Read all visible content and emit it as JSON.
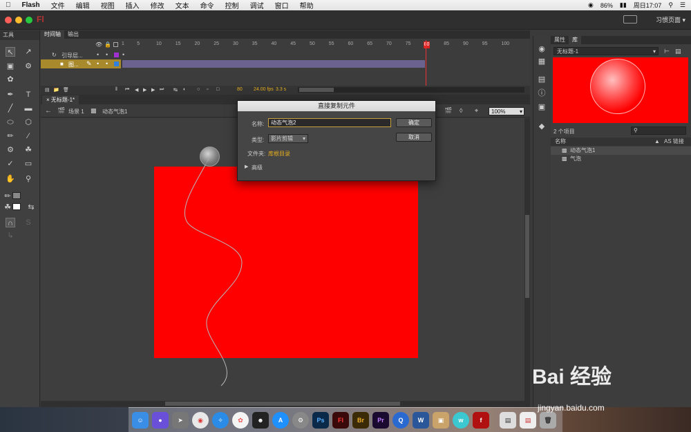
{
  "menubar": {
    "apple_icon": "apple-icon",
    "items": [
      "Flash",
      "文件",
      "编辑",
      "视图",
      "插入",
      "修改",
      "文本",
      "命令",
      "控制",
      "调试",
      "窗口",
      "帮助"
    ],
    "battery": "86%",
    "datetime": "周日17:07"
  },
  "titlebar": {
    "app_logo": "Fl",
    "workspace": "习惯页面"
  },
  "tools": {
    "header": "工具"
  },
  "timeline": {
    "tabs": [
      "时间轴",
      "输出"
    ],
    "ruler": [
      "1",
      "5",
      "10",
      "15",
      "20",
      "25",
      "30",
      "35",
      "40",
      "45",
      "50",
      "55",
      "60",
      "65",
      "70",
      "75",
      "80",
      "85",
      "90",
      "95",
      "100"
    ],
    "current_frame_marker": "80",
    "layers": [
      {
        "name": "引导层..."
      },
      {
        "name": "图..."
      }
    ],
    "status": {
      "frame": "80",
      "fps": "24.00 fps",
      "time": "3.3 s"
    }
  },
  "document": {
    "tab": "无标题-1*",
    "scene": "场景 1",
    "symbol": "动态气泡1",
    "zoom": "100%"
  },
  "library": {
    "tabs": [
      "属性",
      "库"
    ],
    "doc_select": "无标题-1",
    "count": "2 个项目",
    "col_name": "名称",
    "col_link": "AS 链接",
    "items": [
      "动态气泡1",
      "气泡"
    ]
  },
  "dialog": {
    "title": "直接复制元件",
    "name_label": "名称:",
    "name_value": "动态气泡2",
    "type_label": "类型:",
    "type_value": "影片剪辑",
    "folder_label": "文件夹:",
    "folder_value": "库根目录",
    "advanced": "高级",
    "ok": "确定",
    "cancel": "取消"
  },
  "dock": {
    "apps": [
      "Ps",
      "Fl",
      "Br",
      "Pr"
    ]
  },
  "watermark": {
    "brand": "Bai 经验",
    "url": "jingyan.baidu.com"
  },
  "colors": {
    "stage_red": "#ff0000",
    "frame_purple": "#6b6290",
    "active_layer": "#a88a2c",
    "playhead": "#e33333"
  }
}
